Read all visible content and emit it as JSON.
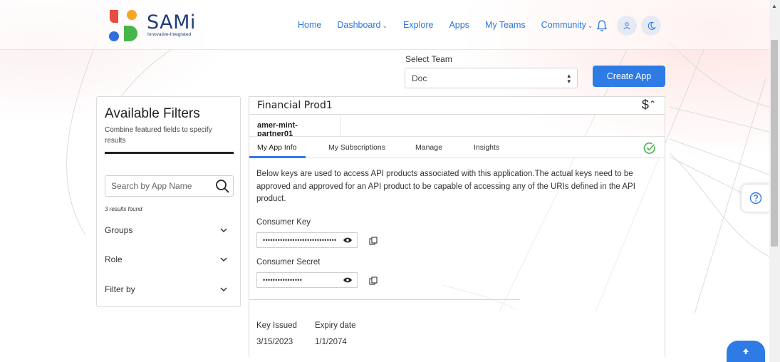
{
  "brand": {
    "name": "SAMi",
    "tagline": "Innovative-Integrated"
  },
  "nav": {
    "items": [
      {
        "label": "Home",
        "has_dropdown": false
      },
      {
        "label": "Dashboard",
        "has_dropdown": true
      },
      {
        "label": "Explore",
        "has_dropdown": false
      },
      {
        "label": "Apps",
        "has_dropdown": false
      },
      {
        "label": "My Teams",
        "has_dropdown": false
      },
      {
        "label": "Community",
        "has_dropdown": true
      }
    ],
    "icons": [
      "bell-icon",
      "user-icon",
      "moon-icon"
    ]
  },
  "team": {
    "label": "Select Team",
    "selected": "Doc"
  },
  "create_app_label": "Create App",
  "filters": {
    "title": "Available Filters",
    "description": "Combine featured fields to specify results",
    "search_placeholder": "Search by App Name",
    "results_found": "3 results found",
    "groups": [
      {
        "label": "Groups"
      },
      {
        "label": "Role"
      },
      {
        "label": "Filter by"
      }
    ]
  },
  "app": {
    "title": "Financial Prod1",
    "currency_symbol": "$",
    "partner": "amer-mint-partner01",
    "tabs": [
      "My App Info",
      "My Subscriptions",
      "Manage",
      "Insights"
    ],
    "active_tab": "My App Info",
    "description": "Below keys are used to access API products associated with this application.The actual keys need to be approved and approved for an API product to be capable of accessing any of the URIs defined in the API product.",
    "consumer_key_label": "Consumer Key",
    "consumer_key_masked": "••••••••••••••••••••••••••••••",
    "consumer_secret_label": "Consumer Secret",
    "consumer_secret_masked": "••••••••••••••••",
    "key_issued_label": "Key Issued",
    "key_issued_value": "3/15/2023",
    "expiry_label": "Expiry date",
    "expiry_value": "1/1/2074"
  },
  "colors": {
    "accent": "#2f7be5",
    "brand_text": "#1f3f7a",
    "success": "#4caf50"
  }
}
